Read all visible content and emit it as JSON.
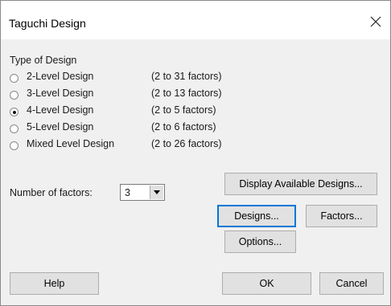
{
  "window": {
    "title": "Taguchi Design"
  },
  "type_group": {
    "label": "Type of Design"
  },
  "design_types": [
    {
      "label": "2-Level Design",
      "range": "(2 to 31 factors)",
      "checked": false
    },
    {
      "label": "3-Level Design",
      "range": "(2 to 13 factors)",
      "checked": false
    },
    {
      "label": "4-Level Design",
      "range": "(2 to 5 factors)",
      "checked": true
    },
    {
      "label": "5-Level Design",
      "range": "(2 to 6 factors)",
      "checked": false
    },
    {
      "label": "Mixed Level Design",
      "range": "(2 to 26 factors)",
      "checked": false
    }
  ],
  "factors": {
    "label": "Number of factors:",
    "value": "3"
  },
  "buttons": {
    "display_available": "Display Available Designs...",
    "designs": "Designs...",
    "factors": "Factors...",
    "options": "Options...",
    "help": "Help",
    "ok": "OK",
    "cancel": "Cancel"
  },
  "icons": {
    "close": "close-icon",
    "dropdown": "chevron-down-icon"
  }
}
